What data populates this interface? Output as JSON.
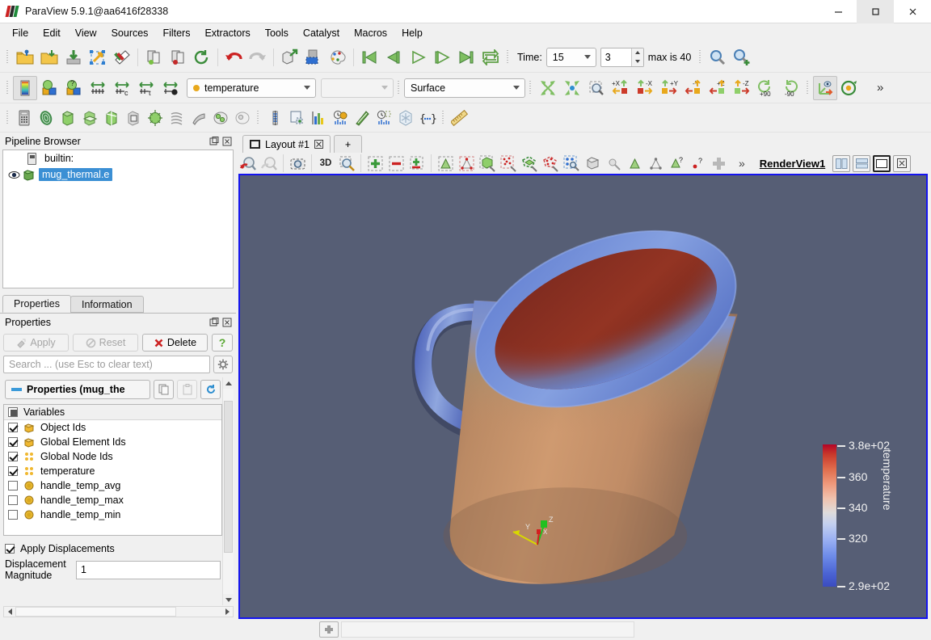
{
  "window": {
    "title": "ParaView 5.9.1@aa6416f28338",
    "minimize": "–",
    "maximize": "☐",
    "close": "✕"
  },
  "menubar": {
    "items": [
      "File",
      "Edit",
      "View",
      "Sources",
      "Filters",
      "Extractors",
      "Tools",
      "Catalyst",
      "Macros",
      "Help"
    ]
  },
  "toolbar_main": {
    "buttons": [
      "open-file",
      "recent-files",
      "save-data",
      "save-state",
      "save-screenshot",
      "connect-server",
      "disconnect-server",
      "reset-session",
      "undo",
      "redo",
      "camera-undo-redo",
      "select-color-map",
      "edit-color-palette"
    ],
    "vcr": [
      "first-frame",
      "previous-frame",
      "play",
      "next-frame",
      "last-frame",
      "loop"
    ],
    "time_label": "Time:",
    "time_value": "15",
    "frame_value": "3",
    "max_label": "max is 40",
    "magnify": [
      "zoom-to-data",
      "zoom-to-data-add"
    ]
  },
  "toolbar_repr": {
    "color_legend_button": "toggle-color-legend",
    "array_name": "temperature",
    "vector_component": "",
    "representation": "Surface",
    "camera_buttons": [
      "+X",
      "-X",
      "+Y",
      "-Y",
      "+Z",
      "-Z"
    ],
    "rotate_labels": [
      "+90",
      "-90"
    ],
    "overflow": "»"
  },
  "toolbar_filters": {
    "buttons": [
      "calculator",
      "contour",
      "clip",
      "slice",
      "threshold",
      "extract-subset",
      "glyph",
      "stream-tracer",
      "warp",
      "group-datasets",
      "extract-level",
      "spreadsheet",
      "plot-data",
      "histogram",
      "plot-over-time",
      "plot-data-over-line",
      "quartile-chart",
      "python-shell",
      "macros",
      "ruler"
    ]
  },
  "pipeline_browser": {
    "title": "Pipeline Browser",
    "items": [
      {
        "label": "builtin:",
        "type": "server",
        "selected": false,
        "visible": false
      },
      {
        "label": "mug_thermal.e",
        "type": "source",
        "selected": true,
        "visible": true
      }
    ]
  },
  "panel_tabs": [
    {
      "label": "Properties",
      "active": true
    },
    {
      "label": "Information",
      "active": false
    }
  ],
  "properties": {
    "title": "Properties",
    "apply_label": "Apply",
    "reset_label": "Reset",
    "delete_label": "Delete",
    "help_label": "?",
    "search_placeholder": "Search ... (use Esc to clear text)",
    "group_header": "Properties (mug_the",
    "variables_header": "Variables",
    "variables": [
      {
        "label": "Object Ids",
        "checked": true,
        "icon": "cell-data-icon"
      },
      {
        "label": "Global Element Ids",
        "checked": true,
        "icon": "cell-data-icon"
      },
      {
        "label": "Global Node Ids",
        "checked": true,
        "icon": "point-data-icon"
      },
      {
        "label": "temperature",
        "checked": true,
        "icon": "point-data-icon"
      },
      {
        "label": "handle_temp_avg",
        "checked": false,
        "icon": "field-data-icon"
      },
      {
        "label": "handle_temp_max",
        "checked": false,
        "icon": "field-data-icon"
      },
      {
        "label": "handle_temp_min",
        "checked": false,
        "icon": "field-data-icon"
      }
    ],
    "apply_displacements_label": "Apply Displacements",
    "apply_displacements_checked": true,
    "displacement_magnitude_label": "Displacement\nMagnitude",
    "displacement_magnitude_label_line1": "Displacement",
    "displacement_magnitude_label_line2": "Magnitude",
    "displacement_magnitude_value": "1"
  },
  "layout": {
    "tab_label": "Layout #1",
    "tab_close": "☒",
    "add_tab": "+"
  },
  "view_toolbar": {
    "buttons": [
      "interaction-undo",
      "interaction-redo",
      "camera-snapshot",
      "3D",
      "zoom-closest",
      "add-selection",
      "subtract-selection",
      "toggle-selection",
      "select-cells-surface",
      "select-points-surface",
      "select-cells-frustum",
      "select-points-frustum",
      "select-cells-polygon",
      "select-points-polygon",
      "select-blocks",
      "interactive-select-cells",
      "hover-points",
      "select-cells-tooltip",
      "select-points-tooltip",
      "grow-selection"
    ],
    "mode_3d": "3D",
    "overflow": "»",
    "view_name": "RenderView1",
    "split_horizontal": "split-horizontal",
    "split_vertical": "split-vertical",
    "maximize_view": "maximize",
    "close_view": "close"
  },
  "render_view": {
    "background_color": "#565e75",
    "outline_color": "#1414f0",
    "orientation_axes": [
      {
        "axis": "X",
        "color": "#d42020"
      },
      {
        "axis": "Y",
        "color": "#d8d800"
      },
      {
        "axis": "Z",
        "color": "#20c020"
      }
    ]
  },
  "color_legend": {
    "title": "temperature",
    "tick_labels": [
      "3.8e+02",
      "360",
      "340",
      "320",
      "2.9e+02"
    ],
    "range_min": "2.9e+02",
    "range_max": "3.8e+02",
    "colormap": "Cool to Warm",
    "text_color": "#f2f2f2"
  },
  "status_bar": {
    "button": "abort-button",
    "progress_text": ""
  },
  "colors": {
    "selection_blue": "#3b8fd4",
    "view_border": "#1414f0",
    "panel_bg": "#f0f0f0",
    "mug_body": "#c08c63",
    "mug_rim": "#6a85d0",
    "mug_interior": "#8e2e20"
  }
}
